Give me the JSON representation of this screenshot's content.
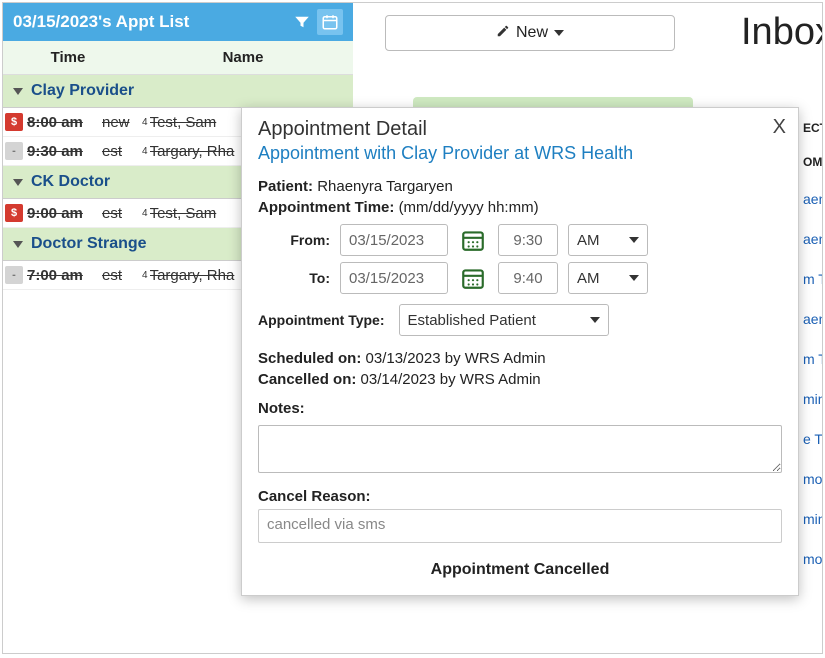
{
  "appt_panel": {
    "header_title": "03/15/2023's Appt List",
    "col_time": "Time",
    "col_name": "Name",
    "groups": [
      {
        "name": "Clay Provider",
        "rows": [
          {
            "badge": "$",
            "badge_style": "red",
            "time": "8:00 am",
            "status": "new",
            "sup": "4",
            "name": "Test, Sam"
          },
          {
            "badge": "-",
            "badge_style": "gray",
            "time": "9:30 am",
            "status": "est",
            "sup": "4",
            "name": "Targary, Rha"
          }
        ]
      },
      {
        "name": "CK Doctor",
        "rows": [
          {
            "badge": "$",
            "badge_style": "red",
            "time": "9:00 am",
            "status": "est",
            "sup": "4",
            "name": "Test, Sam"
          }
        ]
      },
      {
        "name": "Doctor Strange",
        "rows": [
          {
            "badge": "-",
            "badge_style": "gray",
            "time": "7:00 am",
            "status": "est",
            "sup": "4",
            "name": "Targary, Rha"
          }
        ]
      }
    ]
  },
  "topbar": {
    "new_label": "New",
    "inbox_title": "Inbox"
  },
  "rlinks": {
    "head1": "ECT",
    "head2": "OM",
    "items": [
      "aen",
      "aen",
      "m T",
      "aen",
      "m T",
      "min",
      "e T",
      "mo",
      "min",
      "mo"
    ]
  },
  "modal": {
    "title": "Appointment Detail",
    "subtitle": "Appointment with Clay Provider at WRS Health",
    "patient_label": "Patient:",
    "patient_value": "Rhaenyra Targaryen",
    "time_label": "Appointment Time:",
    "time_hint": "(mm/dd/yyyy hh:mm)",
    "from_label": "From:",
    "to_label": "To:",
    "from_date": "03/15/2023",
    "from_time": "9:30",
    "from_ampm": "AM",
    "to_date": "03/15/2023",
    "to_time": "9:40",
    "to_ampm": "AM",
    "type_label": "Appointment Type:",
    "type_value": "Established Patient",
    "scheduled_label": "Scheduled on:",
    "scheduled_value": "03/13/2023 by WRS Admin",
    "cancelled_label": "Cancelled on:",
    "cancelled_value": "03/14/2023 by WRS Admin",
    "notes_label": "Notes:",
    "cancel_reason_label": "Cancel Reason:",
    "cancel_reason_value": "cancelled via sms",
    "foot": "Appointment Cancelled"
  }
}
